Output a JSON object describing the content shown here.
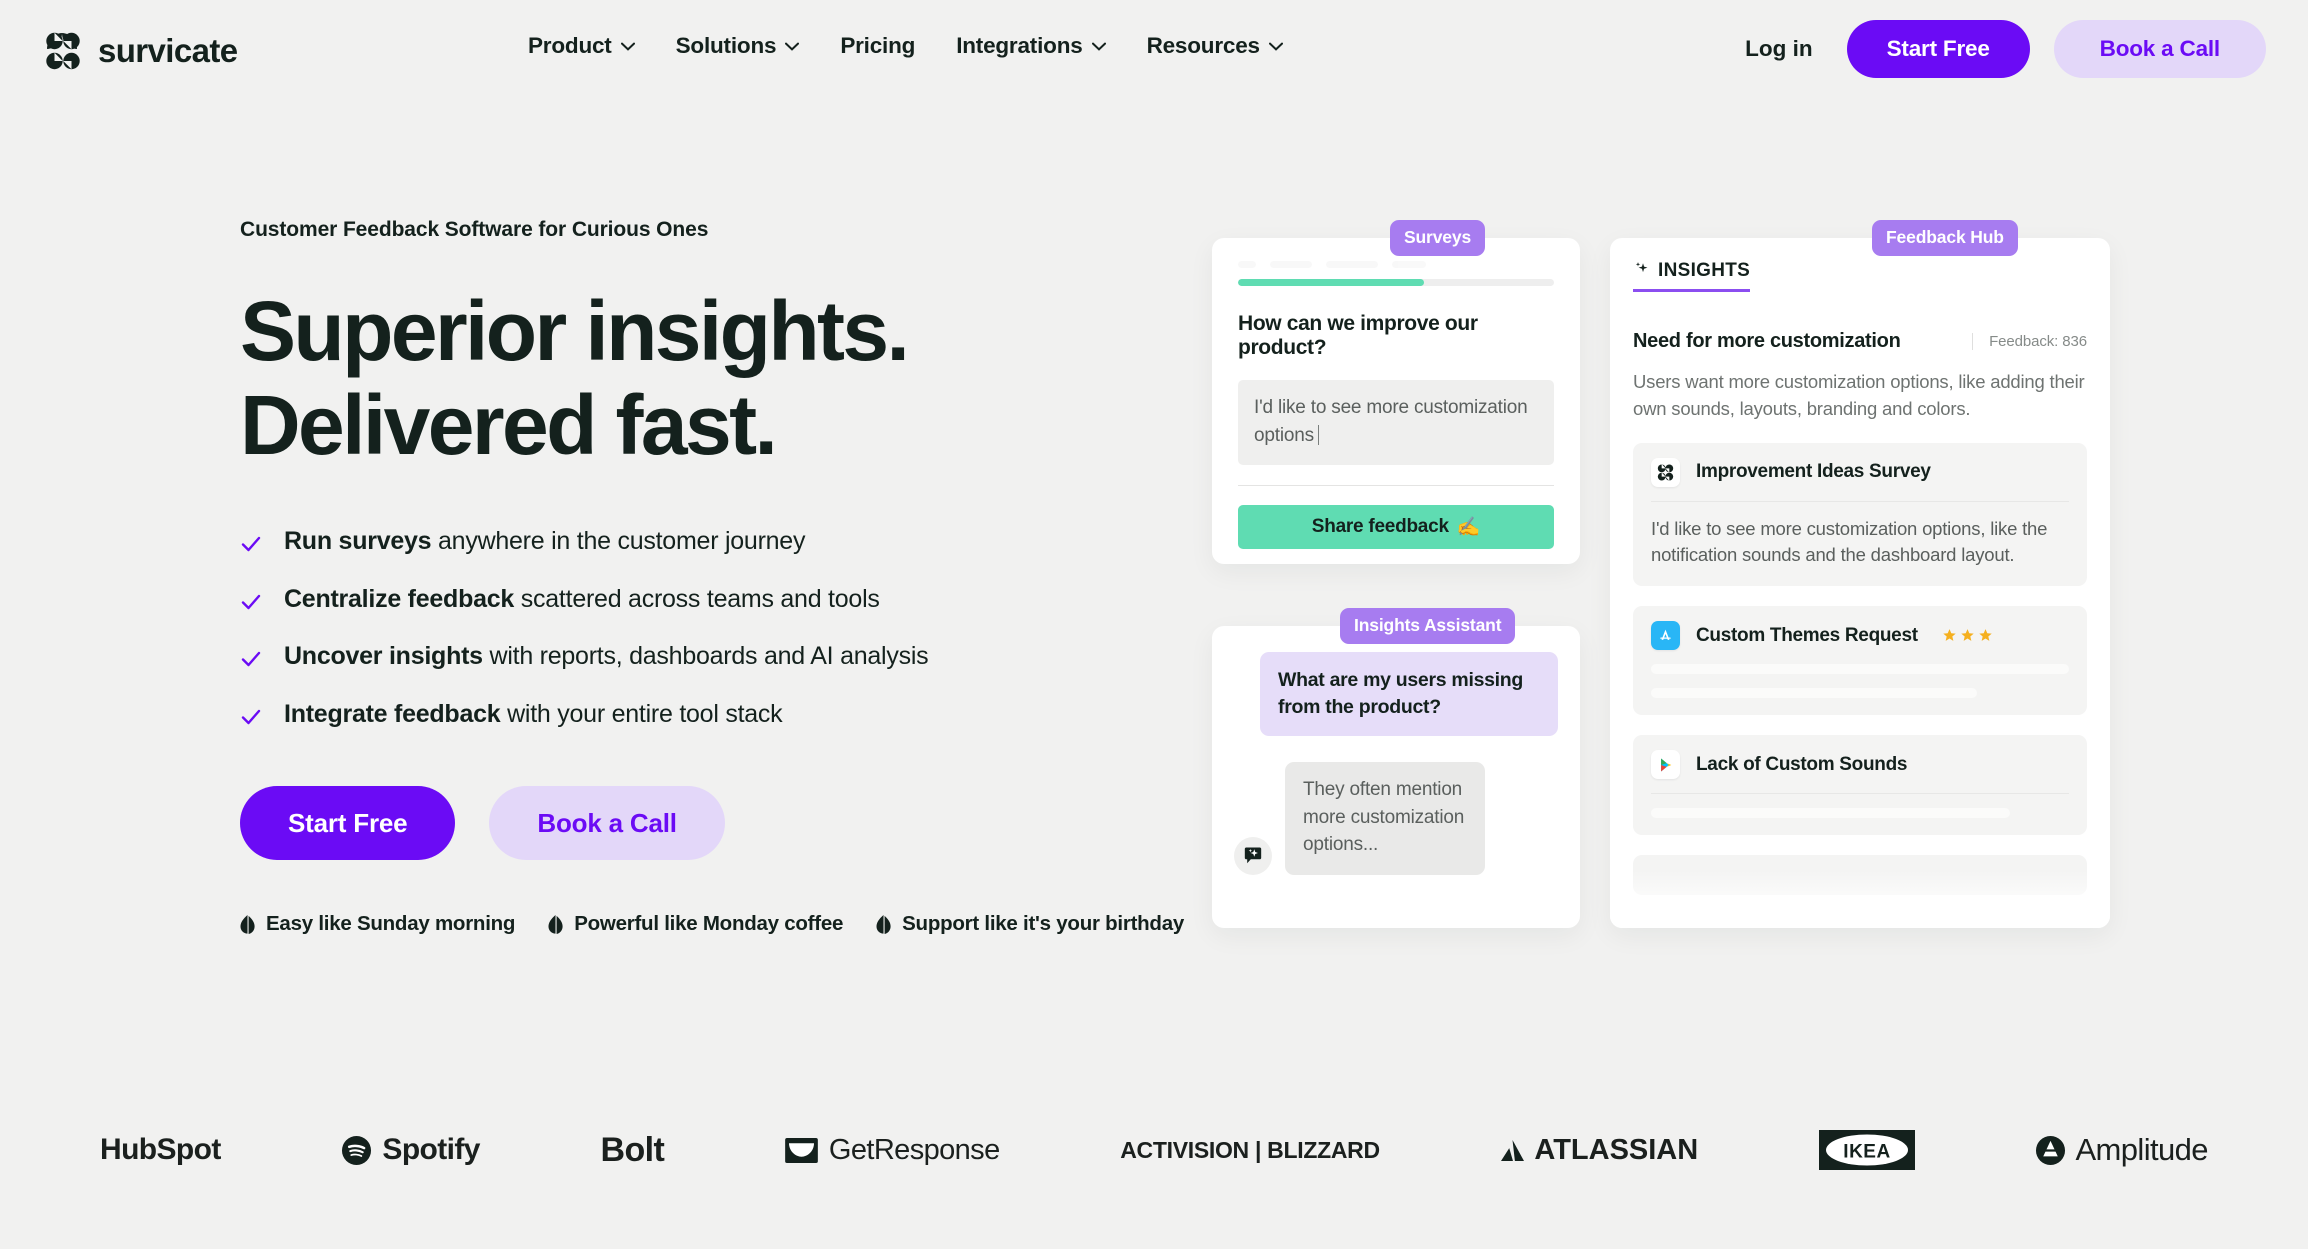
{
  "brand": {
    "name": "survicate",
    "mark_icon": "survicate-pinwheel-logo"
  },
  "nav": {
    "items": [
      {
        "label": "Product",
        "has_dropdown": true
      },
      {
        "label": "Solutions",
        "has_dropdown": true
      },
      {
        "label": "Pricing",
        "has_dropdown": false
      },
      {
        "label": "Integrations",
        "has_dropdown": true
      },
      {
        "label": "Resources",
        "has_dropdown": true
      }
    ],
    "login_label": "Log in",
    "start_free_label": "Start Free",
    "book_call_label": "Book a Call"
  },
  "hero": {
    "eyebrow": "Customer Feedback Software for Curious Ones",
    "headline_line1": "Superior insights.",
    "headline_line2": "Delivered fast.",
    "bullets": [
      {
        "bold": "Run surveys",
        "rest": " anywhere in the customer journey"
      },
      {
        "bold": "Centralize feedback",
        "rest": " scattered across teams and tools"
      },
      {
        "bold": "Uncover insights",
        "rest": " with reports, dashboards and AI analysis"
      },
      {
        "bold": "Integrate feedback",
        "rest": " with your entire tool stack"
      }
    ],
    "cta_primary": "Start Free",
    "cta_secondary": "Book a Call",
    "taglines": [
      "Easy like Sunday morning",
      "Powerful like Monday coffee",
      "Support like it's your birthday"
    ]
  },
  "cards": {
    "survey": {
      "pill": "Surveys",
      "progress_percent": 59,
      "question": "How can we improve our product?",
      "answer_value": "I'd like to see more customization options",
      "submit_label": "Share feedback",
      "submit_emoji": "✍️"
    },
    "assistant": {
      "pill": "Insights Assistant",
      "user_message": "What are my users missing from the product?",
      "ai_message": "They often mention more customization options...",
      "avatar_icon": "ai-sparkle-chat-icon"
    },
    "hub": {
      "pill": "Feedback Hub",
      "section_label": "INSIGHTS",
      "section_icon": "sparkle-icon",
      "insight_title": "Need for more customization",
      "insight_count": "Feedback: 836",
      "insight_description": "Users want more customization options, like adding their own sounds, layouts, branding and colors.",
      "items": [
        {
          "icon": "survicate-app-icon",
          "title": "Improvement Ideas Survey",
          "body": "I'd like to see more customization options, like the notification sounds and the dashboard layout.",
          "stars": 0
        },
        {
          "icon": "app-store-icon",
          "title": "Custom Themes Request",
          "body": "",
          "stars": 3
        },
        {
          "icon": "google-play-icon",
          "title": "Lack of Custom Sounds",
          "body": "",
          "stars": 0
        }
      ]
    }
  },
  "logos": [
    {
      "name": "HubSpot",
      "icon": "hubspot-logo"
    },
    {
      "name": "Spotify",
      "icon": "spotify-logo"
    },
    {
      "name": "Bolt",
      "icon": "bolt-logo"
    },
    {
      "name": "GetResponse",
      "icon": "getresponse-logo"
    },
    {
      "name": "ACTIVISION | BLIZZARD",
      "icon": "activision-blizzard-logo"
    },
    {
      "name": "ATLASSIAN",
      "icon": "atlassian-logo"
    },
    {
      "name": "IKEA",
      "icon": "ikea-logo"
    },
    {
      "name": "Amplitude",
      "icon": "amplitude-logo"
    }
  ],
  "colors": {
    "page_bg": "#f1f1f0",
    "brand_purple": "#6b0bf5",
    "soft_purple": "#e3d7f9",
    "pill_purple": "#a77cf0",
    "mint": "#5fdcb2",
    "ink": "#14211d"
  }
}
